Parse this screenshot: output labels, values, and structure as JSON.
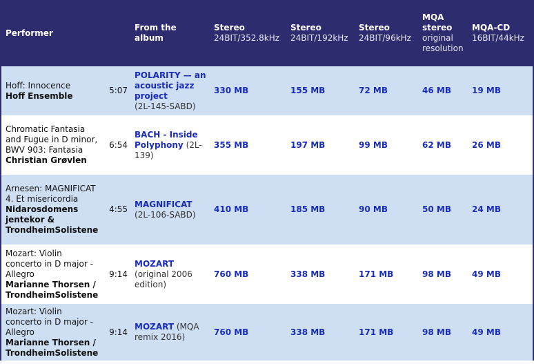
{
  "header": {
    "performer": "Performer",
    "album": "From the album",
    "col1": {
      "title": "Stereo",
      "sub": "24BIT/352.8kHz"
    },
    "col2": {
      "title": "Stereo",
      "sub": "24BIT/192kHz"
    },
    "col3": {
      "title": "Stereo",
      "sub": "24BIT/96kHz"
    },
    "col4": {
      "title": "MQA stereo",
      "sub": "original resolution"
    },
    "col5": {
      "title": "MQA-CD",
      "sub": "16BIT/44kHz"
    }
  },
  "rows": [
    {
      "work": "Hoff: Innocence",
      "performer": "Hoff Ensemble",
      "duration": "5:07",
      "album_link": "POLARITY — an acoustic jazz project",
      "album_rest": "(2L-145-SABD)",
      "sizes": [
        "330 MB",
        "155 MB",
        "72 MB",
        "46 MB",
        "19 MB"
      ]
    },
    {
      "work": "Chromatic Fantasia and Fugue in D minor, BWV 903: Fantasia",
      "performer": "Christian Grøvlen",
      "duration": "6:54",
      "album_link": "BACH - Inside Polyphony",
      "album_rest": "(2L-139)",
      "sizes": [
        "355 MB",
        "197 MB",
        "99 MB",
        "62 MB",
        "26 MB"
      ]
    },
    {
      "work": "Arnesen: MAGNIFICAT 4. Et misericordia",
      "performer": "Nidarosdomens jentekor & TrondheimSolistene",
      "duration": "4:55",
      "album_link": "MAGNIFICAT",
      "album_rest": "(2L-106-SABD)",
      "sizes": [
        "410 MB",
        "185 MB",
        "90 MB",
        "50 MB",
        "24 MB"
      ]
    },
    {
      "work": "Mozart: Violin concerto in D major - Allegro",
      "performer": "Marianne Thorsen / TrondheimSolistene",
      "duration": "9:14",
      "album_link": "MOZART",
      "album_rest": "(original 2006 edition)",
      "sizes": [
        "760 MB",
        "338 MB",
        "171 MB",
        "98 MB",
        "49 MB"
      ]
    },
    {
      "work": "Mozart: Violin concerto in D major - Allegro",
      "performer": "Marianne Thorsen / TrondheimSolistene",
      "duration": "9:14",
      "album_link": "MOZART",
      "album_rest": "(MQA remix 2016)",
      "sizes": [
        "760 MB",
        "338 MB",
        "171 MB",
        "98 MB",
        "49 MB"
      ]
    }
  ]
}
